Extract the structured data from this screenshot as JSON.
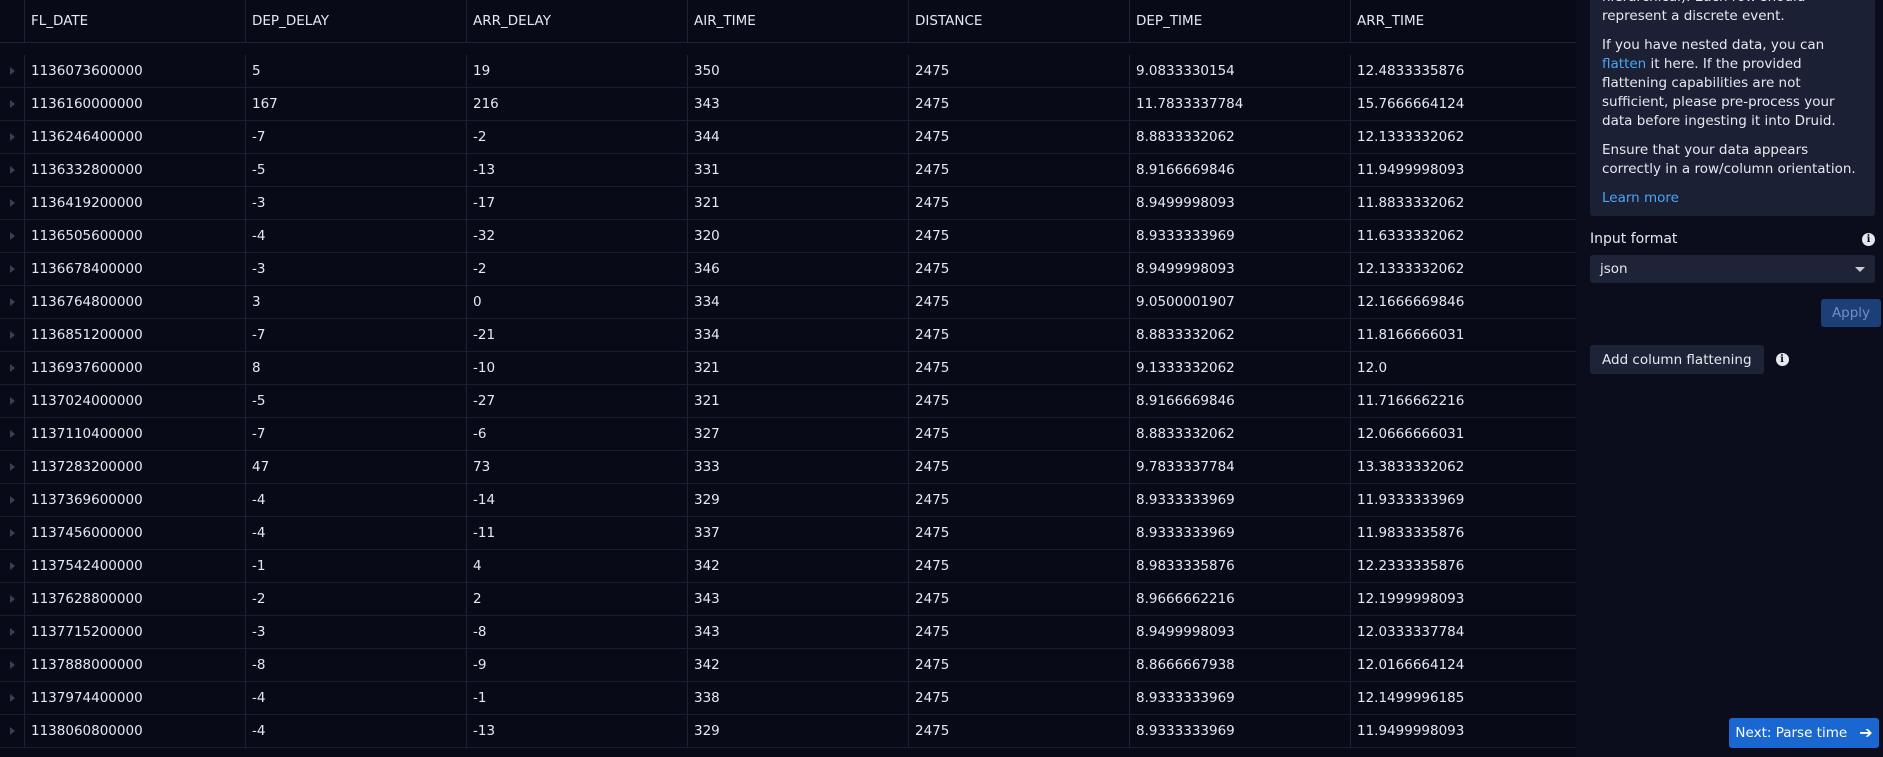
{
  "table": {
    "columns": [
      "FL_DATE",
      "DEP_DELAY",
      "ARR_DELAY",
      "AIR_TIME",
      "DISTANCE",
      "DEP_TIME",
      "ARR_TIME"
    ],
    "rows": [
      [
        "1136073600000",
        "5",
        "19",
        "350",
        "2475",
        "9.0833330154",
        "12.4833335876"
      ],
      [
        "1136160000000",
        "167",
        "216",
        "343",
        "2475",
        "11.7833337784",
        "15.7666664124"
      ],
      [
        "1136246400000",
        "-7",
        "-2",
        "344",
        "2475",
        "8.8833332062",
        "12.1333332062"
      ],
      [
        "1136332800000",
        "-5",
        "-13",
        "331",
        "2475",
        "8.9166669846",
        "11.9499998093"
      ],
      [
        "1136419200000",
        "-3",
        "-17",
        "321",
        "2475",
        "8.9499998093",
        "11.8833332062"
      ],
      [
        "1136505600000",
        "-4",
        "-32",
        "320",
        "2475",
        "8.9333333969",
        "11.6333332062"
      ],
      [
        "1136678400000",
        "-3",
        "-2",
        "346",
        "2475",
        "8.9499998093",
        "12.1333332062"
      ],
      [
        "1136764800000",
        "3",
        "0",
        "334",
        "2475",
        "9.0500001907",
        "12.1666669846"
      ],
      [
        "1136851200000",
        "-7",
        "-21",
        "334",
        "2475",
        "8.8833332062",
        "11.8166666031"
      ],
      [
        "1136937600000",
        "8",
        "-10",
        "321",
        "2475",
        "9.1333332062",
        "12.0"
      ],
      [
        "1137024000000",
        "-5",
        "-27",
        "321",
        "2475",
        "8.9166669846",
        "11.7166662216"
      ],
      [
        "1137110400000",
        "-7",
        "-6",
        "327",
        "2475",
        "8.8833332062",
        "12.0666666031"
      ],
      [
        "1137283200000",
        "47",
        "73",
        "333",
        "2475",
        "9.7833337784",
        "13.3833332062"
      ],
      [
        "1137369600000",
        "-4",
        "-14",
        "329",
        "2475",
        "8.9333333969",
        "11.9333333969"
      ],
      [
        "1137456000000",
        "-4",
        "-11",
        "337",
        "2475",
        "8.9333333969",
        "11.9833335876"
      ],
      [
        "1137542400000",
        "-1",
        "4",
        "342",
        "2475",
        "8.9833335876",
        "12.2333335876"
      ],
      [
        "1137628800000",
        "-2",
        "2",
        "343",
        "2475",
        "8.9666662216",
        "12.1999998093"
      ],
      [
        "1137715200000",
        "-3",
        "-8",
        "343",
        "2475",
        "8.9499998093",
        "12.0333337784"
      ],
      [
        "1137888000000",
        "-8",
        "-9",
        "342",
        "2475",
        "8.8666667938",
        "12.0166664124"
      ],
      [
        "1137974400000",
        "-4",
        "-1",
        "338",
        "2475",
        "8.9333333969",
        "12.1499996185"
      ],
      [
        "1138060800000",
        "-4",
        "-13",
        "329",
        "2475",
        "8.9333333969",
        "11.9499998093"
      ]
    ]
  },
  "info": {
    "p1": "hierarchical). Each row should represent a discrete event.",
    "p2_pre": "If you have nested data, you can ",
    "p2_link": "flatten",
    "p2_post": " it here. If the provided flattening capabilities are not sufficient, please pre-process your data before ingesting it into Druid.",
    "p3": "Ensure that your data appears correctly in a row/column orientation.",
    "learn_more": "Learn more"
  },
  "input_format": {
    "label": "Input format",
    "value": "json"
  },
  "buttons": {
    "apply": "Apply",
    "add_flattening": "Add column flattening",
    "next": "Next: Parse time"
  },
  "colors": {
    "background": "#0b0d1c",
    "panel": "#1b2034",
    "link": "#4aa6f2",
    "primary": "#1a67d2"
  }
}
